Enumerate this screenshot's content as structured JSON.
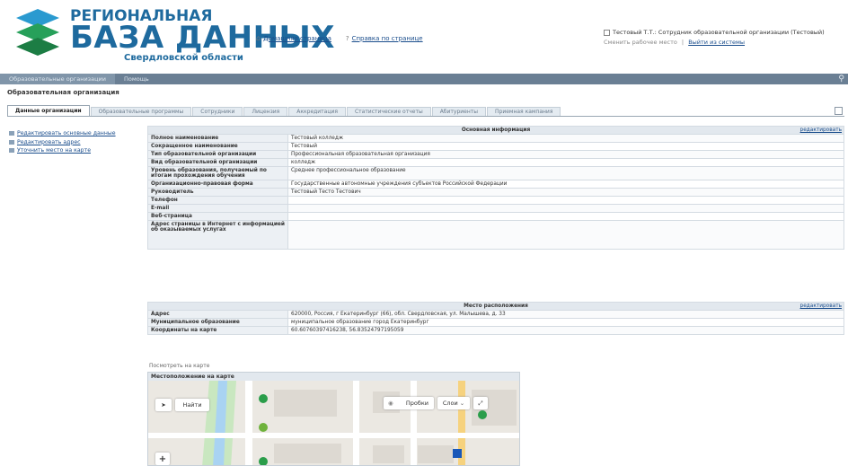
{
  "logo": {
    "line1": "РЕГИОНАЛЬНАЯ",
    "line2": "БАЗА ДАННЫХ",
    "line3": "Свердловской области"
  },
  "header_links": [
    {
      "icon": "home-icon",
      "label": "Домашняя страница"
    },
    {
      "icon": "help-icon",
      "label": "Справка по странице"
    }
  ],
  "user": {
    "name": "Тестовый Т.Т.: Сотрудник образовательной организации (Тестовый)",
    "change_workplace": "Сменить рабочее место",
    "separator": "|",
    "logout": "Выйти из системы"
  },
  "menu": {
    "items": [
      "Образовательные организации",
      "Помощь"
    ],
    "search_icon": "search-icon"
  },
  "page_title": "Образовательная организация",
  "tabs": [
    "Данные организации",
    "Образовательные программы",
    "Сотрудники",
    "Лицензия",
    "Аккредитация",
    "Статистические отчеты",
    "Абитуриенты",
    "Приемная кампания"
  ],
  "sidebar": {
    "items": [
      "Редактировать основные данные",
      "Редактировать адрес",
      "Уточнить место на карте"
    ]
  },
  "main_info": {
    "title": "Основная информация",
    "edit_label": "редактировать",
    "rows": [
      {
        "key": "Полное наименование",
        "value": "Тестовый колледж"
      },
      {
        "key": "Сокращенное наименование",
        "value": "Тестовый"
      },
      {
        "key": "Тип образовательной организации",
        "value": "Профессиональная образовательная организация"
      },
      {
        "key": "Вид образовательной организации",
        "value": "колледж"
      },
      {
        "key": "Уровень образования, получаемый по итогам прохождения обучения",
        "value": "Среднее профессиональное образование"
      },
      {
        "key": "Организационно-правовая форма",
        "value": "Государственные автономные учреждения субъектов Российской Федерации"
      },
      {
        "key": "Руководитель",
        "value": "Тестовый Тесто Тестович"
      },
      {
        "key": "Телефон",
        "value": ""
      },
      {
        "key": "E-mail",
        "value": ""
      },
      {
        "key": "Веб-страница",
        "value": ""
      },
      {
        "key": "Адрес страницы в Интернет с информацией об оказываемых услугах",
        "value": ""
      }
    ]
  },
  "location": {
    "title": "Место расположения",
    "edit_label": "редактировать",
    "rows": [
      {
        "key": "Адрес",
        "value": "620000, Россия, г Екатеринбург (66), обл. Свердловская, ул. Малышева, д. 33"
      },
      {
        "key": "Муниципальное образование",
        "value": "муниципальное образование город Екатеринбург"
      },
      {
        "key": "Координаты на карте",
        "value": "60.60760397416238, 56.83524797195059"
      }
    ]
  },
  "map": {
    "view_label": "Посмотреть на карте",
    "title": "Местоположение на карте",
    "find_label": "Найти",
    "traffic_label": "Пробки",
    "layers_label": "Слои",
    "zoom_in": "+"
  }
}
